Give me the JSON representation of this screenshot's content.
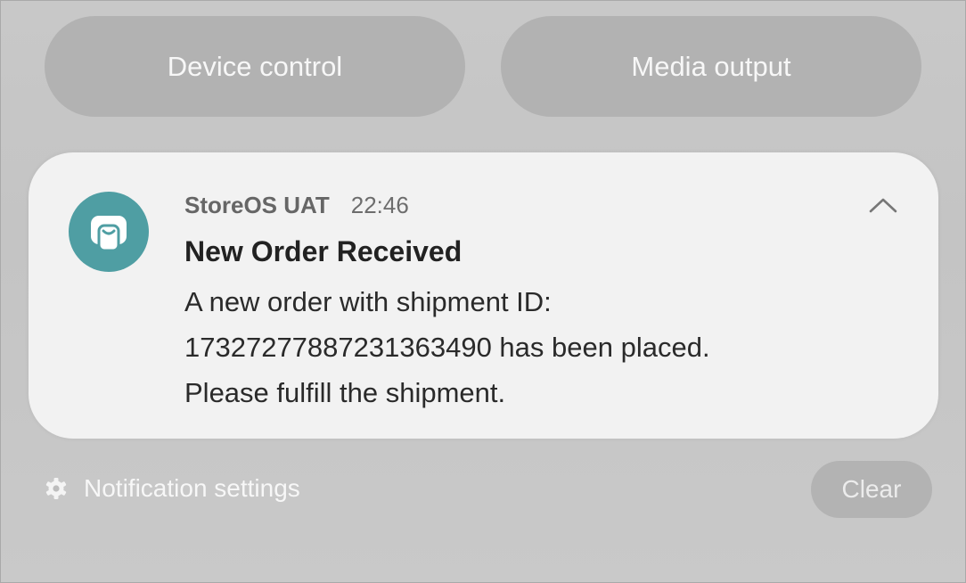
{
  "quick_buttons": {
    "device_control": "Device control",
    "media_output": "Media output"
  },
  "notification": {
    "app_icon": "storeos-app-icon",
    "app_name": "StoreOS UAT",
    "time": "22:46",
    "title": "New Order Received",
    "body_lines": [
      "A new order with shipment ID:",
      "17327277887231363490 has been placed.",
      "Please fulfill the shipment."
    ],
    "collapse_icon": "chevron-up-icon"
  },
  "footer": {
    "settings_icon": "gear-icon",
    "settings_label": "Notification settings",
    "clear_label": "Clear"
  },
  "colors": {
    "background": "#c6c6c6",
    "pill": "#b2b2b2",
    "card": "#f2f2f2",
    "app_icon_bg": "#4f9ea3"
  }
}
